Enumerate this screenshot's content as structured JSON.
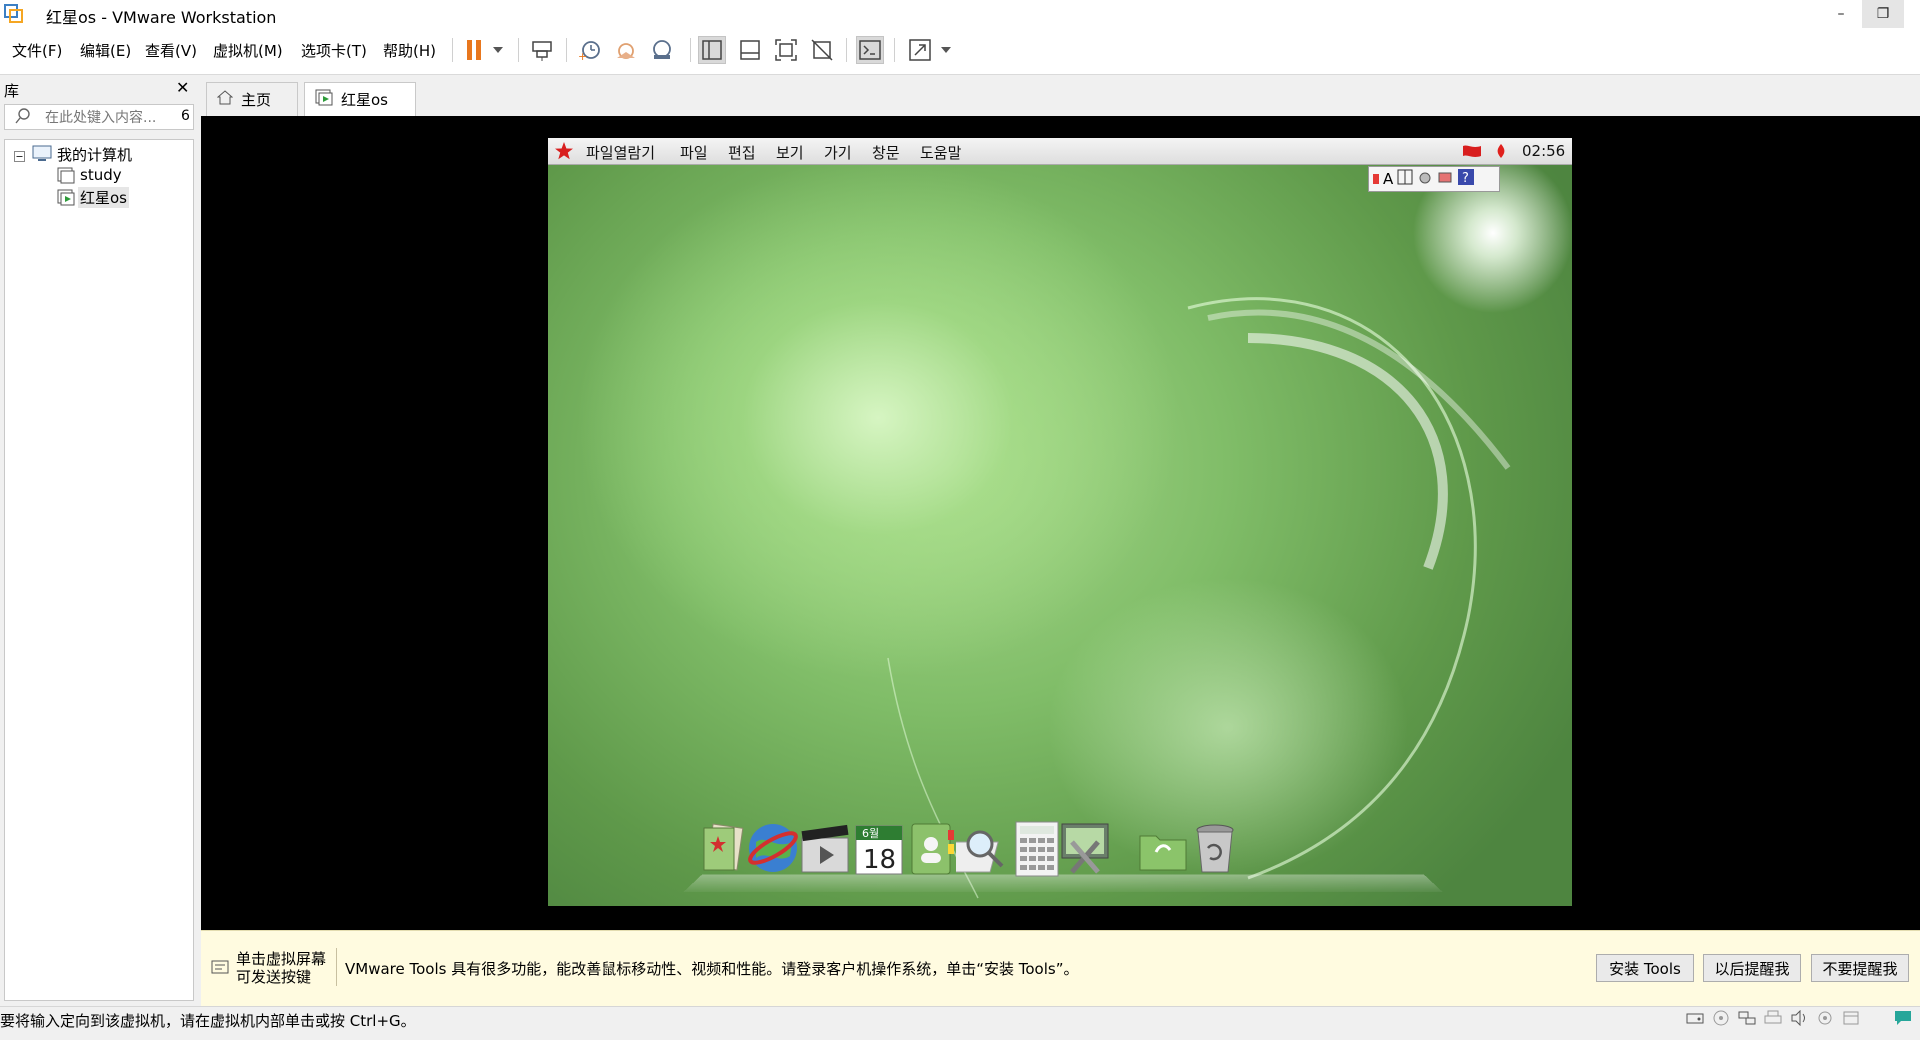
{
  "window": {
    "title": "红星os - VMware Workstation",
    "logo_icon": "vmware-logo-icon",
    "minimize_icon": "minimize-icon",
    "restore_icon": "restore-icon",
    "minimize_glyph": "–",
    "restore_glyph": "❐"
  },
  "menu": {
    "items": [
      "文件(F)",
      "编辑(E)",
      "查看(V)",
      "虚拟机(M)",
      "选项卡(T)",
      "帮助(H)"
    ]
  },
  "toolbar": {
    "icons": [
      "pause-icon",
      "dropdown-icon",
      "send-ctrl-alt-del-icon",
      "snapshot-icon",
      "revert-snapshot-icon",
      "snapshot-manager-icon",
      "show-library-icon",
      "show-thumbnail-icon",
      "full-screen-icon",
      "unity-icon",
      "console-view-icon",
      "stretch-guest-icon",
      "dropdown-icon"
    ],
    "accent_color": "#e8771e"
  },
  "library": {
    "title": "库",
    "close_glyph": "✕",
    "search_placeholder": "在此处键入内容...",
    "search_count": "6",
    "tree": {
      "root": "我的计算机",
      "items": [
        "study",
        "红星os"
      ]
    }
  },
  "tabs": [
    {
      "label": "主页",
      "icon": "home-icon"
    },
    {
      "label": "红星os",
      "icon": "vm-running-icon"
    }
  ],
  "guest": {
    "menu": [
      "파일열람기",
      "파일",
      "편집",
      "보기",
      "가기",
      "창문",
      "도움말"
    ],
    "start_icon": "red-star-icon",
    "clock": "02:56",
    "ime": {
      "letter": "A"
    },
    "dock": {
      "calendar_month": "6월",
      "calendar_day": "18",
      "icons": [
        "documents-icon",
        "browser-globe-icon",
        "video-player-icon",
        "calendar-icon",
        "address-book-icon",
        "search-magnifier-icon",
        "calculator-icon",
        "system-settings-icon",
        "folder-icon",
        "trash-icon"
      ]
    }
  },
  "notification": {
    "hint_line1": "单击虚拟屏幕",
    "hint_line2": "可发送按键",
    "message": "VMware Tools 具有很多功能，能改善鼠标移动性、视频和性能。请登录客户机操作系统，单击“安装 Tools”。",
    "buttons": [
      "安装 Tools",
      "以后提醒我",
      "不要提醒我"
    ]
  },
  "status": {
    "text": "要将输入定向到该虚拟机，请在虚拟机内部单击或按 Ctrl+G。",
    "icons": [
      "hard-disk-icon",
      "cd-rom-icon",
      "network-icon",
      "printer-icon",
      "sound-icon",
      "usb-icon",
      "display-icon",
      "message-icon"
    ]
  }
}
